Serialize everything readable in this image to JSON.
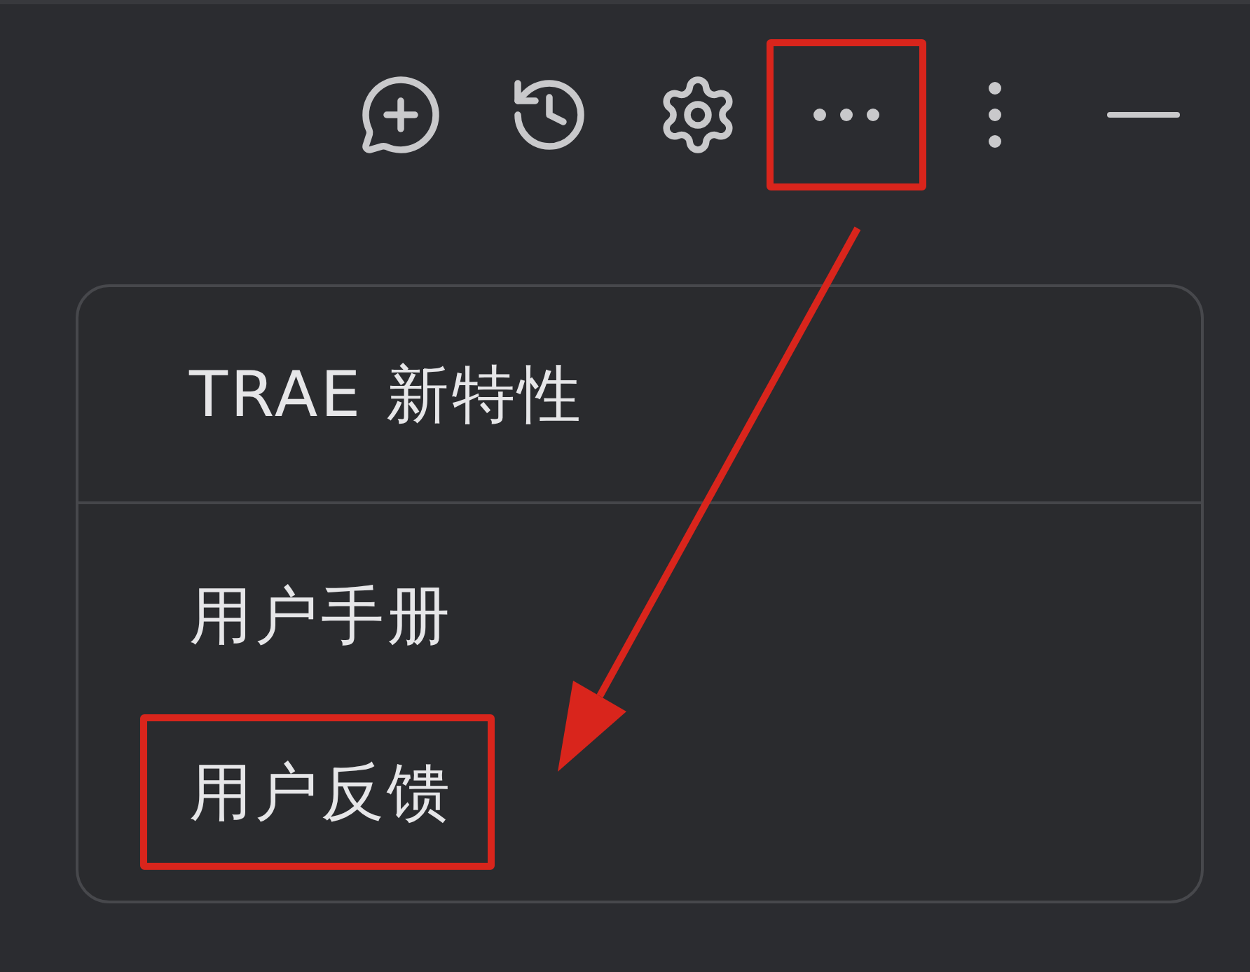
{
  "toolbar": {
    "buttons": [
      {
        "kind": "new-chat",
        "highlighted": false
      },
      {
        "kind": "history",
        "highlighted": false
      },
      {
        "kind": "settings",
        "highlighted": false
      },
      {
        "kind": "more",
        "highlighted": true
      },
      {
        "kind": "more-vertical",
        "highlighted": false
      },
      {
        "kind": "minimize",
        "highlighted": false
      }
    ]
  },
  "menu": {
    "sections": [
      {
        "items": [
          {
            "label": "TRAE 新特性",
            "highlighted": false
          }
        ]
      },
      {
        "items": [
          {
            "label": "用户手册",
            "highlighted": false
          },
          {
            "label": "用户反馈",
            "highlighted": true
          }
        ]
      }
    ]
  }
}
